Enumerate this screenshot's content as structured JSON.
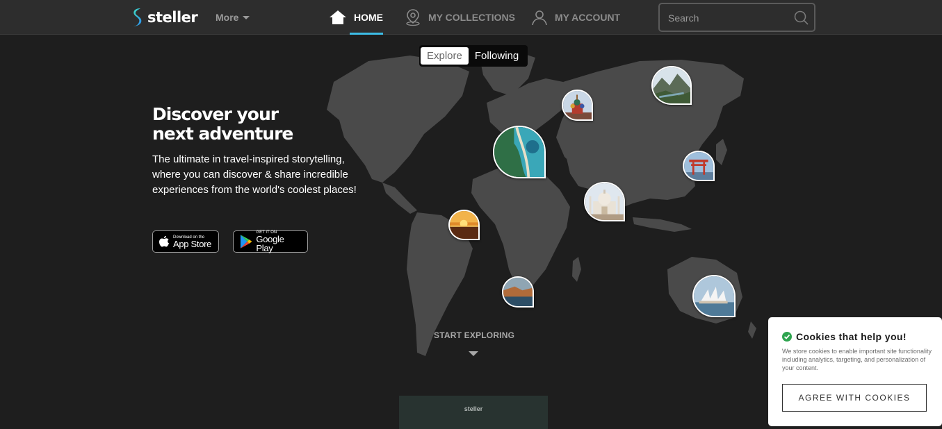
{
  "brand": {
    "name": "steller",
    "accent": "#3dbde6"
  },
  "header": {
    "more_label": "More",
    "nav": [
      {
        "label": "HOME",
        "icon": "home-icon",
        "active": true
      },
      {
        "label": "MY COLLECTIONS",
        "icon": "map-pin-icon",
        "active": false
      },
      {
        "label": "MY ACCOUNT",
        "icon": "user-icon",
        "active": false
      }
    ],
    "search": {
      "placeholder": "Search",
      "value": "",
      "icon": "search-icon"
    }
  },
  "feed_toggle": {
    "options": [
      "Explore",
      "Following"
    ],
    "selected": "Explore"
  },
  "hero": {
    "title_line1": "Discover your",
    "title_line2": "next adventure",
    "subtitle": "The ultimate in travel-inspired storytelling, where you can discover & share incredible experiences from the world's coolest places!"
  },
  "stores": {
    "apple": {
      "small": "Download on the",
      "big": "App Store",
      "icon": "apple-icon"
    },
    "google": {
      "small": "GET IT ON",
      "big": "Google Play",
      "icon": "google-play-icon"
    }
  },
  "map_pins": [
    "moscow-cathedral-photo",
    "mountain-valley-photo",
    "coastline-aerial-photo",
    "torii-gate-photo",
    "taj-mahal-photo",
    "sunset-ocean-photo",
    "coastal-cliffs-photo",
    "sydney-opera-house-photo"
  ],
  "start_exploring": "START EXPLORING",
  "preview_card_label": "steller",
  "cookie": {
    "title": "Cookies that help you!",
    "body": "We store cookies to enable important site functionality including analytics, targeting, and personalization of your content.",
    "button": "AGREE WITH COOKIES",
    "check_color": "#2ea44f"
  }
}
